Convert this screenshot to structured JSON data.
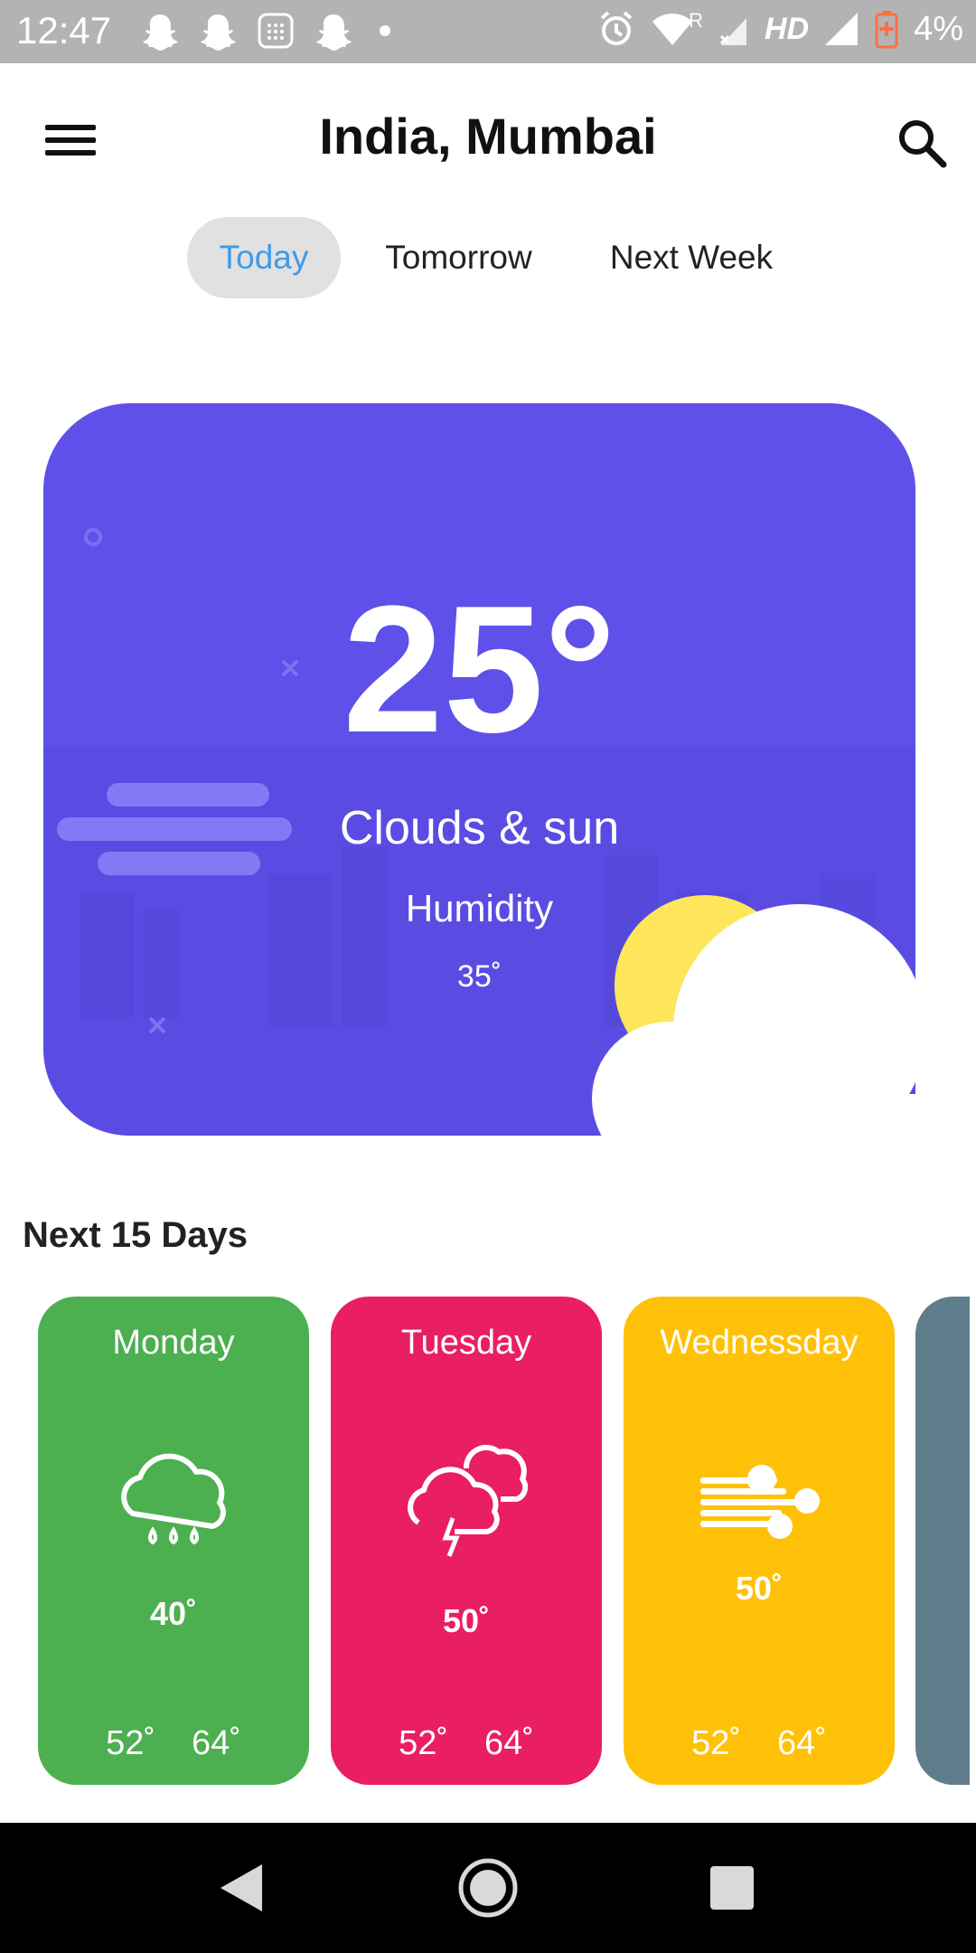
{
  "status_bar": {
    "time": "12:47",
    "network_label": "HD",
    "battery_text": "4%",
    "roaming": "R"
  },
  "header": {
    "title": "India, Mumbai"
  },
  "tabs": [
    {
      "label": "Today",
      "active": true
    },
    {
      "label": "Tomorrow",
      "active": false
    },
    {
      "label": "Next Week",
      "active": false
    }
  ],
  "current": {
    "temperature": "25°",
    "condition": "Clouds & sun",
    "humidity_label": "Humidity",
    "humidity_value": "35˚"
  },
  "forecast": {
    "section_title": "Next 15 Days",
    "days": [
      {
        "name": "Monday",
        "temp": "40˚",
        "low": "52˚",
        "high": "64˚",
        "icon": "rain-cloud-icon",
        "color": "#4caf50"
      },
      {
        "name": "Tuesday",
        "temp": "50˚",
        "low": "52˚",
        "high": "64˚",
        "icon": "thunder-cloud-icon",
        "color": "#e91e63"
      },
      {
        "name": "Wednessday",
        "temp": "50˚",
        "low": "52˚",
        "high": "64˚",
        "icon": "wind-icon",
        "color": "#ffc107"
      }
    ],
    "partial_card_color": "#607d8b"
  },
  "colors": {
    "hero_bg": "#5e50e8",
    "tab_active_text": "#3d9be9",
    "status_bar": "#b3b3b3"
  }
}
